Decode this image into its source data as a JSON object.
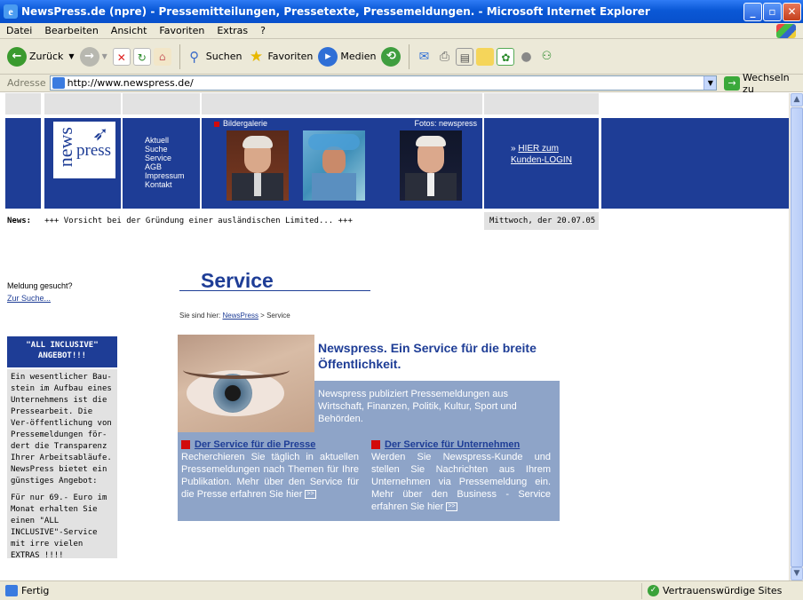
{
  "window": {
    "title": "NewsPress.de (npre) - Pressemitteilungen, Pressetexte, Pressemeldungen. - Microsoft Internet Explorer"
  },
  "menu": [
    "Datei",
    "Bearbeiten",
    "Ansicht",
    "Favoriten",
    "Extras",
    "?"
  ],
  "toolbar": {
    "back": "Zurück",
    "search": "Suchen",
    "favorites": "Favoriten",
    "media": "Medien"
  },
  "address": {
    "label": "Adresse",
    "url": "http://www.newspress.de/",
    "go": "Wechseln zu"
  },
  "site": {
    "logo_news": "news",
    "logo_press": "press",
    "nav": [
      "Aktuell",
      "Suche",
      "Service",
      "AGB",
      "Impressum",
      "Kontakt"
    ],
    "gallery_label": "Bildergalerie",
    "gallery_credit": "Fotos: newspress",
    "login_prefix": "»",
    "login_link_line1": "HIER zum",
    "login_link_line2": "Kunden-LOGIN",
    "ticker_label": "News:",
    "ticker_text": "+++ Vorsicht bei der Gründung einer ausländischen Limited... +++",
    "date": "Mittwoch, der 20.07.05"
  },
  "sidebar": {
    "search_prompt": "Meldung gesucht?",
    "search_link": "Zur Suche...",
    "promo_title": "\"ALL INCLUSIVE\" ANGEBOT!!!",
    "promo_text1": "Ein wesentlicher Bau-stein im Aufbau eines Unternehmens ist die Pressearbeit. Die Ver-öffentlichung von Pressemeldungen för-dert die Transparenz Ihrer Arbeitsabläufe. NewsPress bietet ein günstiges Angebot:",
    "promo_text2": "Für nur 69.- Euro im Monat erhalten Sie einen \"ALL INCLUSIVE\"-Service mit irre vielen EXTRAS !!!!"
  },
  "main": {
    "title": "Service",
    "breadcrumb_prefix": "Sie sind hier:",
    "breadcrumb_link": "NewsPress",
    "breadcrumb_sep": ">",
    "breadcrumb_current": "Service",
    "headline": "Newspress. Ein Service für die breite Öffentlichkeit.",
    "intro": "Newspress publiziert Pressemeldungen aus Wirtschaft, Finanzen, Politik, Kultur, Sport und Behörden.",
    "press_heading": "Der Service für die Presse",
    "press_text": "Recherchieren Sie täglich in aktuellen Pressemeldungen nach Themen für Ihre Publikation. Mehr über den Service für die Presse erfahren Sie hier",
    "biz_heading": "Der Service für Unternehmen",
    "biz_text": "Werden Sie Newspress-Kunde und stellen Sie Nachrichten aus Ihrem Unternehmen via Pressemeldung ein. Mehr über den Business - Service erfahren Sie hier",
    "more_icon": ">>"
  },
  "status": {
    "left": "Fertig",
    "right": "Vertrauenswürdige Sites"
  },
  "colors": {
    "brand_blue": "#1e3d96",
    "panel_blue": "#8ea4c8",
    "accent_red": "#d20a0a"
  }
}
